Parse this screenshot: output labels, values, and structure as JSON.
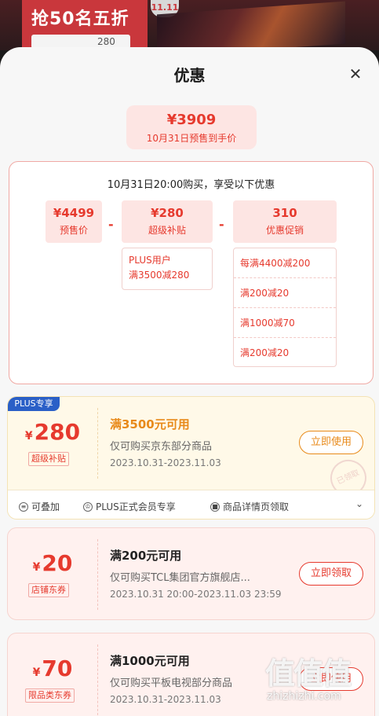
{
  "banner": {
    "title": "抢50名五折",
    "badge": "11.11",
    "sub_value": "280"
  },
  "sheet": {
    "title": "优惠"
  },
  "price": {
    "amount": "¥3909",
    "desc": "10月31日预售到手价"
  },
  "calc": {
    "heading": "10月31日20:00购买，享受以下优惠",
    "items": [
      {
        "value": "¥4499",
        "label": "预售价"
      },
      {
        "value": "¥280",
        "label": "超级补贴"
      },
      {
        "value": "310",
        "label": "优惠促销"
      }
    ],
    "op1": "-",
    "op2": "-",
    "plus_detail": [
      "PLUS用户",
      "满3500减280"
    ],
    "promo_detail": [
      "每满4400减200",
      "满200减20",
      "满1000减70",
      "满200减20"
    ]
  },
  "coupons": [
    {
      "flag": "PLUS专享",
      "currency": "¥",
      "amount": "280",
      "type": "超级补贴",
      "condition": "满3500元可用",
      "desc": "仅可购买京东部分商品",
      "date": "2023.10.31-2023.11.03",
      "button": "立即使用",
      "stamp": "已领取",
      "tags": [
        "可叠加",
        "PLUS正式会员专享",
        "商品详情页领取"
      ]
    },
    {
      "currency": "¥",
      "amount": "20",
      "type": "店铺东券",
      "condition": "满200元可用",
      "desc": "仅可购买TCL集团官方旗舰店...",
      "date": "2023.10.31 20:00-2023.11.03 23:59",
      "button": "立即领取"
    },
    {
      "currency": "¥",
      "amount": "70",
      "type": "限品类东券",
      "condition": "满1000元可用",
      "desc": "仅可购买平板电视部分商品",
      "date": "2023.10.31-2023.11.03",
      "button": "立即使用"
    }
  ],
  "watermark": {
    "glyphs": "值值值",
    "text": "zhizhizhi.com"
  }
}
